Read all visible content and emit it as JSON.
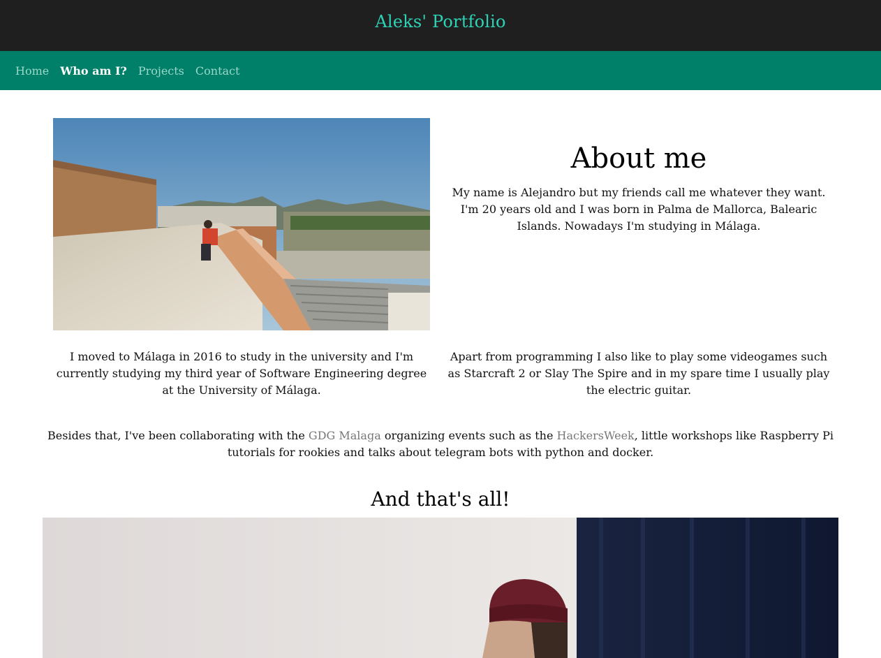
{
  "header": {
    "brand": "Aleks' Portfolio"
  },
  "nav": {
    "items": [
      {
        "label": "Home",
        "active": false
      },
      {
        "label": "Who am I?",
        "active": true
      },
      {
        "label": "Projects",
        "active": false
      },
      {
        "label": "Contact",
        "active": false
      }
    ]
  },
  "about": {
    "title": "About me",
    "intro": "My name is Alejandro but my friends call me whatever they want. I'm 20 years old and I was born in Palma de Mallorca, Balearic Islands. Nowadays I'm studying in Málaga.",
    "study": "I moved to Málaga in 2016 to study in the university and I'm currently studying my third year of Software Engineering degree at the University of Málaga.",
    "hobbies": "Apart from programming I also like to play some videogames such as Starcraft 2 or Slay The Spire and in my spare time I usually play the electric guitar.",
    "besides": {
      "prefix": "Besides that, I've been collaborating with the ",
      "link1": "GDG Malaga",
      "middle": " organizing events such as the ",
      "link2": "HackersWeek",
      "suffix": ", little workshops like Raspberry Pi tutorials for rookies and talks about telegram bots with python and docker."
    },
    "closing": "And that's all!"
  },
  "colors": {
    "topbar": "#1f1f1f",
    "brand": "#2ed3b7",
    "navbar": "#007f69",
    "nav_inactive": "#9ad8c9",
    "link": "#777777"
  }
}
